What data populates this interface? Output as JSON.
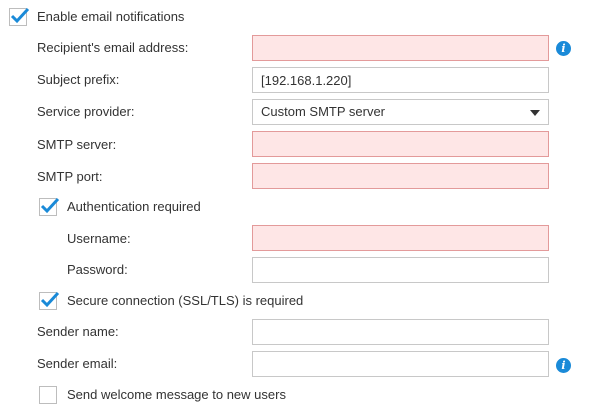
{
  "enable_notifications": {
    "label": "Enable email notifications",
    "checked": true
  },
  "recipient": {
    "label": "Recipient's email address:",
    "value": ""
  },
  "subject_prefix": {
    "label": "Subject prefix:",
    "value": "[192.168.1.220]"
  },
  "service_provider": {
    "label": "Service provider:",
    "selected": "Custom SMTP server"
  },
  "smtp_server": {
    "label": "SMTP server:",
    "value": ""
  },
  "smtp_port": {
    "label": "SMTP port:",
    "value": ""
  },
  "auth_required": {
    "label": "Authentication required",
    "checked": true
  },
  "username": {
    "label": "Username:",
    "value": ""
  },
  "password": {
    "label": "Password:",
    "value": ""
  },
  "secure_connection": {
    "label": "Secure connection (SSL/TLS) is required",
    "checked": true
  },
  "sender_name": {
    "label": "Sender name:",
    "value": ""
  },
  "sender_email": {
    "label": "Sender email:",
    "value": ""
  },
  "welcome_message": {
    "label": "Send welcome message to new users",
    "checked": false
  },
  "info_icon_glyph": "i",
  "colors": {
    "accent": "#1a8ad8",
    "invalid_bg": "#fee6e6",
    "invalid_border": "#e39a9a"
  }
}
